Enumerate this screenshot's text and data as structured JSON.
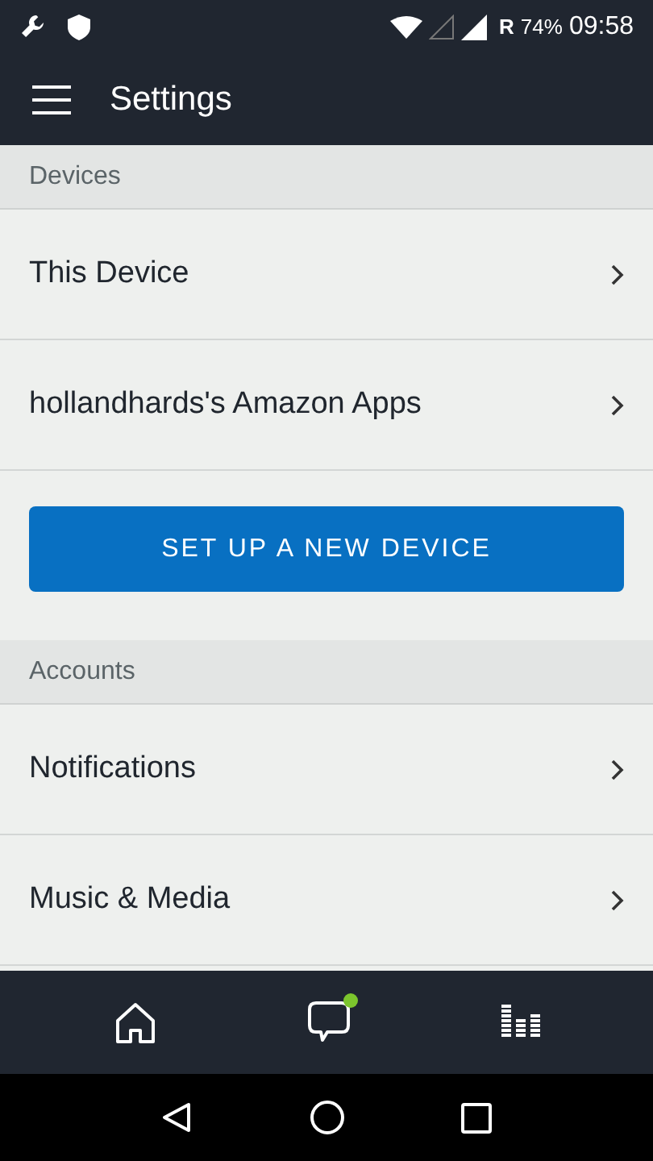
{
  "status_bar": {
    "roaming": "R",
    "battery": "74%",
    "time": "09:58"
  },
  "app_bar": {
    "title": "Settings"
  },
  "sections": [
    {
      "kind": "list",
      "header": "Devices",
      "items": [
        {
          "label": "This Device"
        },
        {
          "label": "hollandhards's Amazon Apps"
        }
      ],
      "button": "SET UP A NEW DEVICE"
    },
    {
      "kind": "list",
      "header": "Accounts",
      "items": [
        {
          "label": "Notifications"
        },
        {
          "label": "Music & Media"
        }
      ]
    }
  ],
  "bottom_nav": [
    {
      "kind": "home",
      "badge": false
    },
    {
      "kind": "chat",
      "badge": true
    },
    {
      "kind": "music",
      "badge": false
    }
  ]
}
